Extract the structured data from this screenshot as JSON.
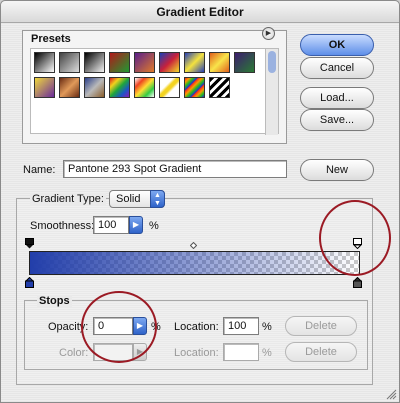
{
  "window": {
    "title": "Gradient Editor"
  },
  "presets": {
    "label": "Presets",
    "swatches": [
      {
        "name": "black-white",
        "bg": "linear-gradient(135deg,#000,#fff)"
      },
      {
        "name": "checker-fade",
        "bg": "linear-gradient(135deg,#444,#ddd)"
      },
      {
        "name": "black-transparent",
        "bg": "linear-gradient(135deg,#000,#f5f5f5)"
      },
      {
        "name": "red-green",
        "bg": "linear-gradient(135deg,#b01919,#1f9a32)"
      },
      {
        "name": "violet-orange",
        "bg": "linear-gradient(135deg,#5a1f8a,#e07b2a)"
      },
      {
        "name": "blue-red-yellow",
        "bg": "linear-gradient(135deg,#1d3fb5,#c8213b,#f2dc2a)"
      },
      {
        "name": "blue-yellow-blue",
        "bg": "linear-gradient(135deg,#2540b8,#f4e23e,#2540b8)"
      },
      {
        "name": "orange-yellow",
        "bg": "linear-gradient(135deg,#e0601c,#f8e44a,#e0601c)"
      },
      {
        "name": "violet-green",
        "bg": "linear-gradient(135deg,#3d1d6e,#2a7a34)"
      },
      {
        "name": "yellow-violet",
        "bg": "linear-gradient(135deg,#f0d83b,#6a2b9c)"
      },
      {
        "name": "copper",
        "bg": "linear-gradient(135deg,#6a2c13,#e19a5a,#6a2c13)"
      },
      {
        "name": "chrome",
        "bg": "linear-gradient(135deg,#2a3f8a,#b9b9b9,#8a5d2a)"
      },
      {
        "name": "spectrum",
        "bg": "linear-gradient(135deg,#d81c1c,#f1d21c,#1fa63a,#1b55c6,#8a1cb5)"
      },
      {
        "name": "transparent-rainbow",
        "bg": "linear-gradient(135deg,#fff,#e42,#fd3,#3c4,#fff)"
      },
      {
        "name": "yellow-stripe",
        "bg": "linear-gradient(135deg,#fff 35%,#f3d321 45%,#f3d321 55%,#fff 65%)"
      },
      {
        "name": "rainbow-stripes",
        "bg": "repeating-linear-gradient(135deg,#e22,#f90 3px,#2b2 6px,#22d 9px)"
      },
      {
        "name": "black-stripes",
        "bg": "repeating-linear-gradient(135deg,#000 0 3px,#fff 3px 6px)"
      }
    ],
    "menu_icon": "right-arrow-circle-icon"
  },
  "buttons": {
    "ok": "OK",
    "cancel": "Cancel",
    "load": "Load...",
    "save": "Save...",
    "new": "New"
  },
  "name_field": {
    "label": "Name:",
    "value": "Pantone 293 Spot Gradient"
  },
  "gradient_type": {
    "label": "Gradient Type:",
    "value": "Solid"
  },
  "smoothness": {
    "label": "Smoothness:",
    "value": "100",
    "unit": "%"
  },
  "stops": {
    "label": "Stops",
    "opacity_label": "Opacity:",
    "opacity_value": "0",
    "opacity_unit": "%",
    "opacity_location_label": "Location:",
    "opacity_location_value": "100",
    "opacity_location_unit": "%",
    "opacity_delete": "Delete",
    "color_label": "Color:",
    "color_location_label": "Location:",
    "color_location_value": "",
    "color_location_unit": "%",
    "color_delete": "Delete"
  },
  "colors": {
    "accent": "#3a6ad4",
    "gradient_start": "#223eaa",
    "annotation_circle": "#9b1a24"
  }
}
